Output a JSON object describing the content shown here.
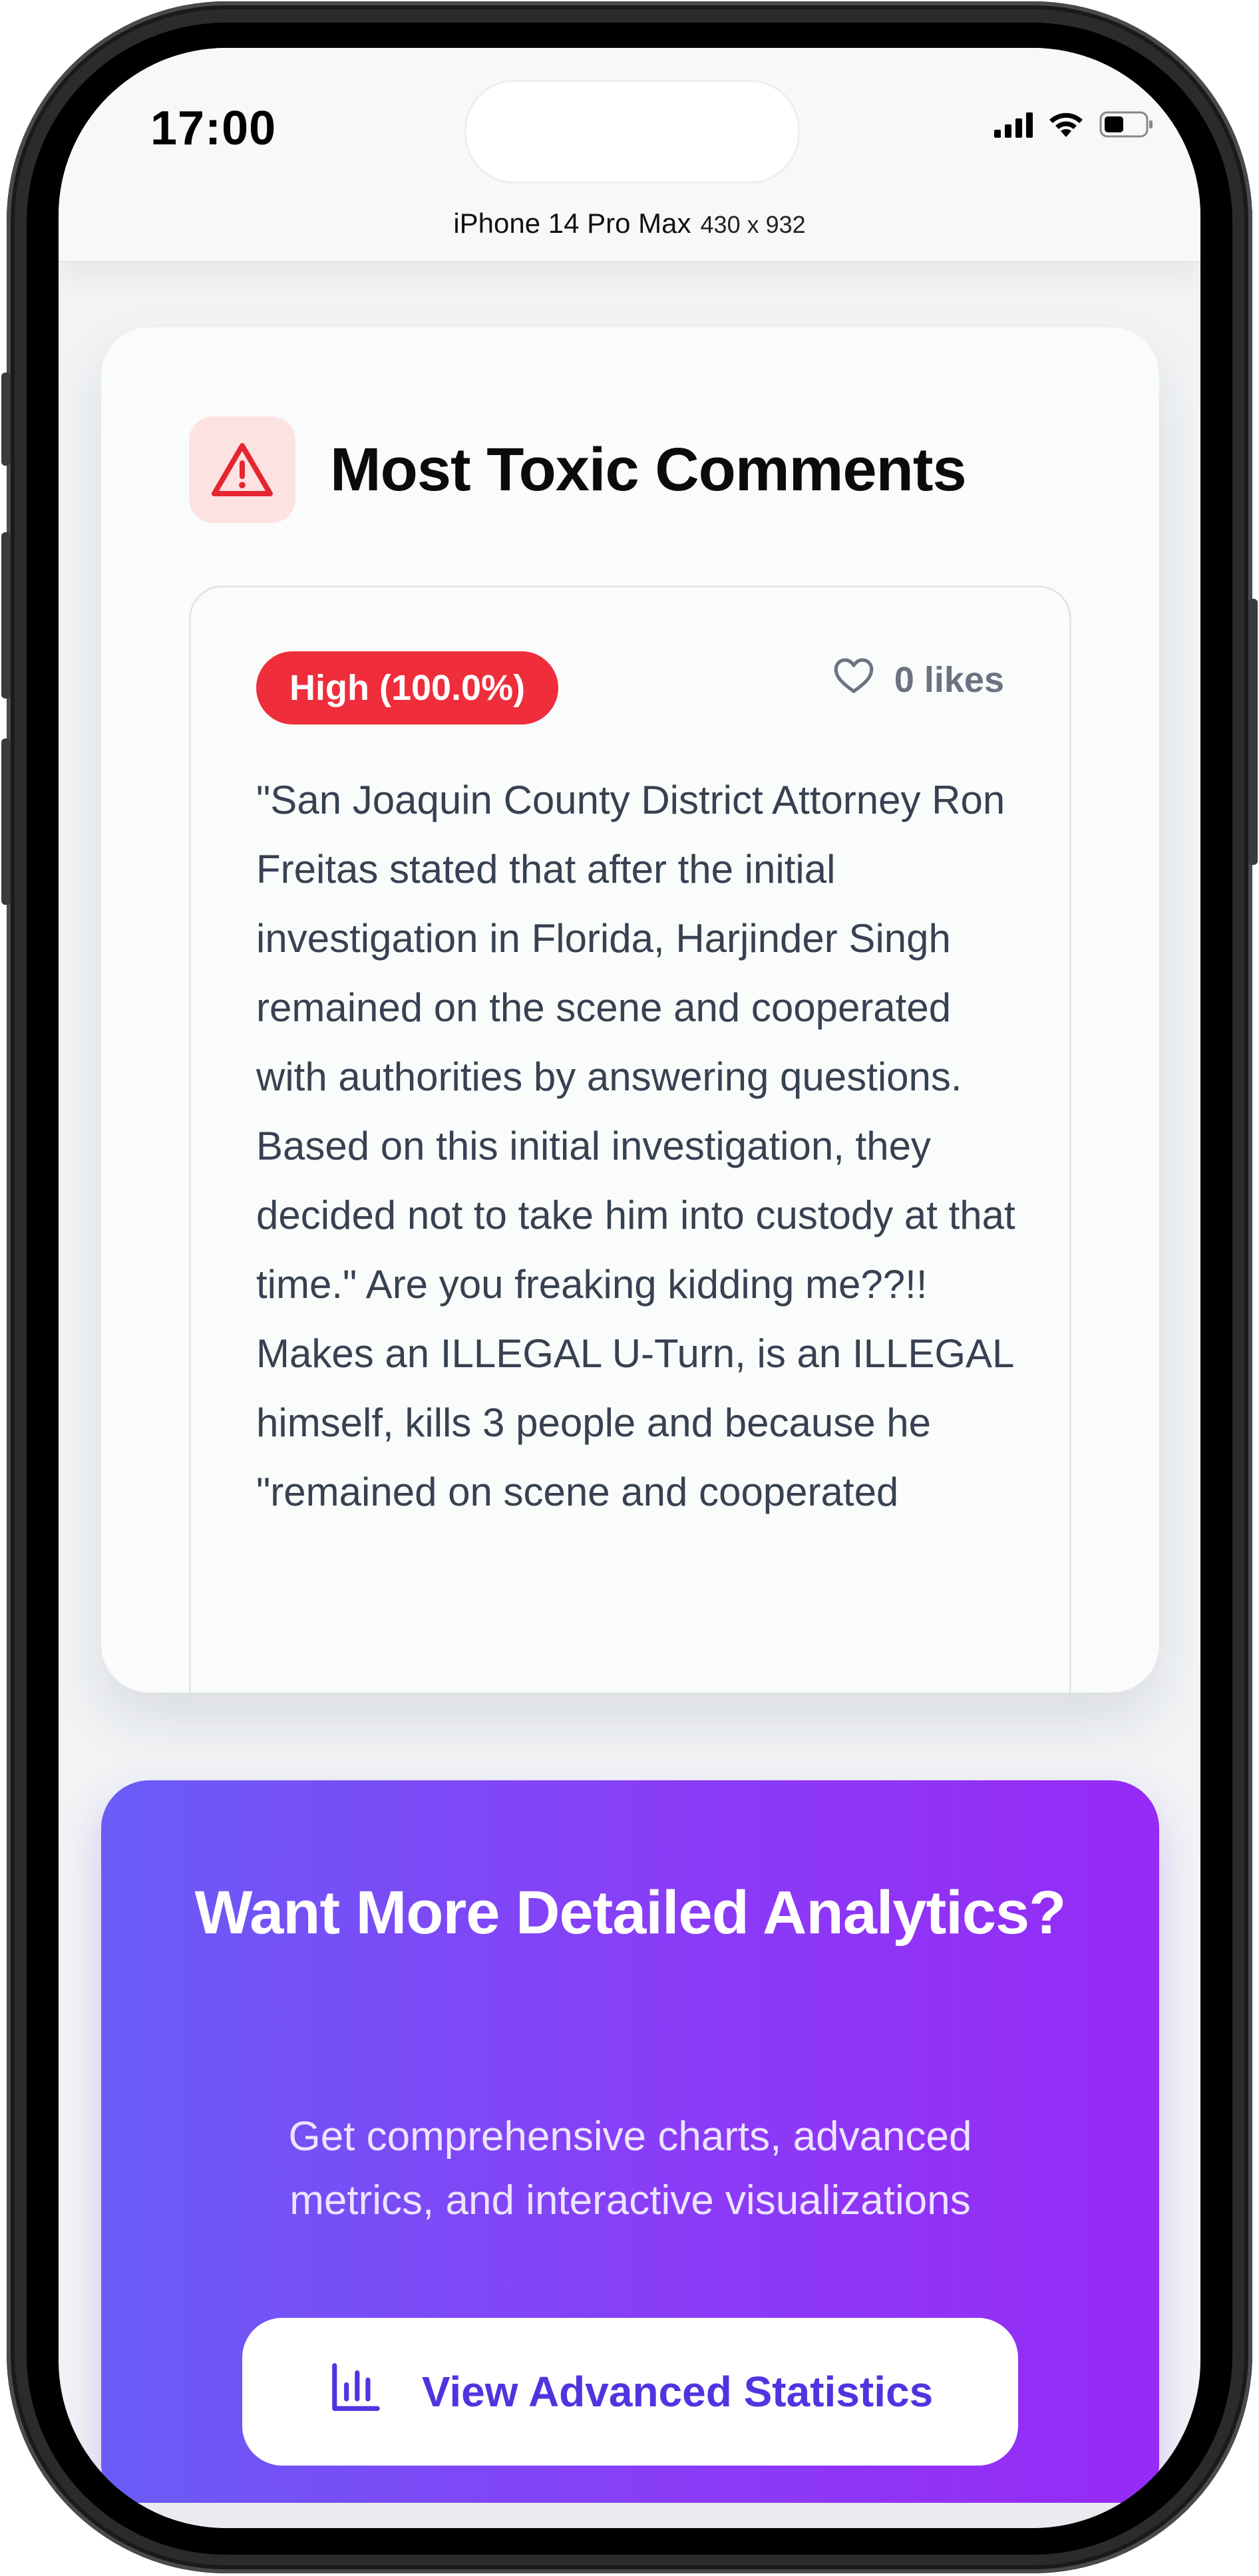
{
  "status_bar": {
    "time": "17:00",
    "device_name": "iPhone 14 Pro Max",
    "device_dims": "430 x 932"
  },
  "toxic_card": {
    "title": "Most Toxic Comments",
    "icon": "warning-triangle-icon",
    "comment": {
      "severity_badge": "High (100.0%)",
      "likes_label": "0 likes",
      "text": "\"San Joaquin County District Attorney Ron Freitas stated that after the initial investigation in Florida, Harjinder Singh remained on the scene and cooperated with authorities by answering questions. Based on this initial investigation, they decided not to take him into custody at that time.\" Are you freaking kidding me??!! Makes an ILLEGAL U-Turn, is an ILLEGAL himself, kills 3 people and because he \"remained on scene and cooperated"
    }
  },
  "cta": {
    "title": "Want More Detailed Analytics?",
    "subtitle": "Get comprehensive charts, advanced metrics, and interactive visualizations",
    "button_label": "View Advanced Statistics",
    "button_icon": "bar-chart-icon"
  },
  "colors": {
    "danger": "#ef2d3b",
    "danger_bg": "#fde2e2",
    "gradient_start": "#6a5cf6",
    "gradient_end": "#962af6",
    "button_text": "#4f35e0"
  }
}
